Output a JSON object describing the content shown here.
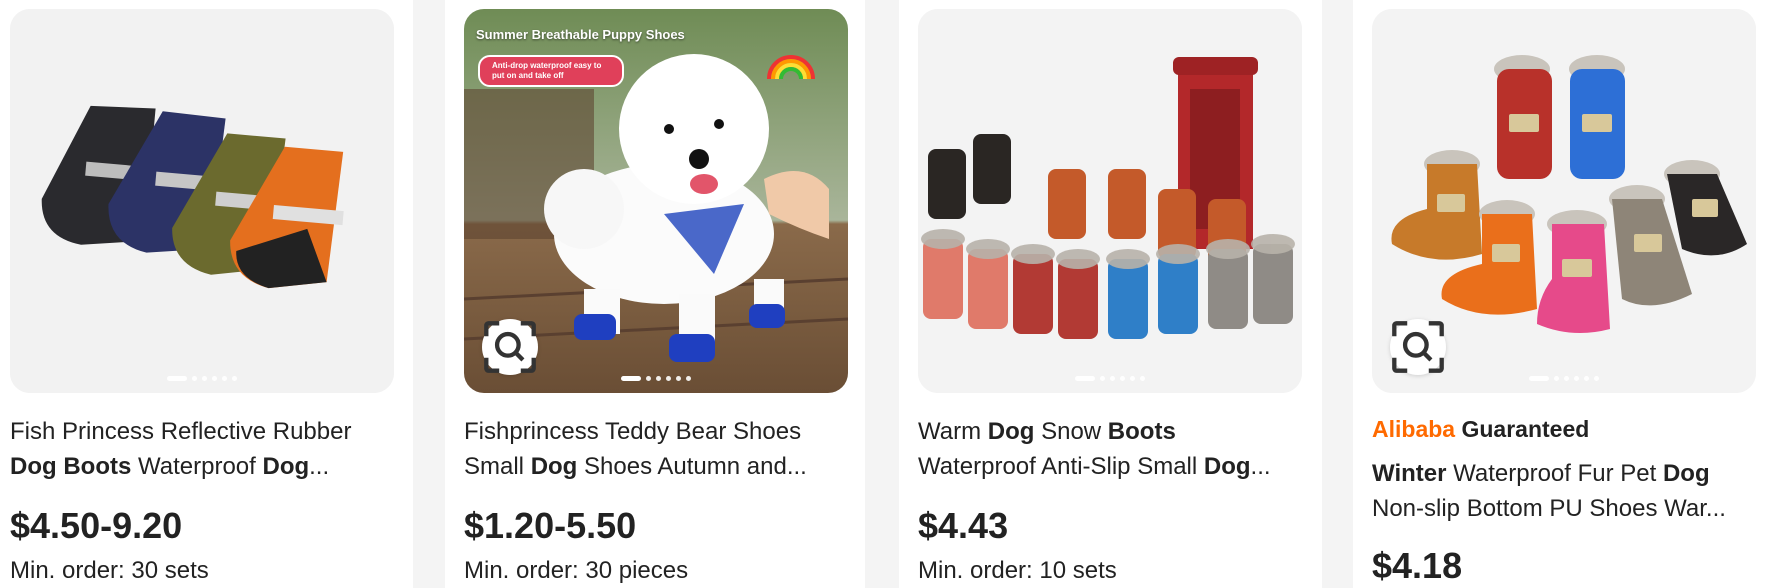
{
  "products": [
    {
      "title_line1": [
        {
          "t": "Fish Princess Reflective Rubber",
          "b": false
        }
      ],
      "title_line2": [
        {
          "t": "Dog",
          "b": true
        },
        {
          "t": " ",
          "b": false
        },
        {
          "t": "Boots",
          "b": true
        },
        {
          "t": " Waterproof ",
          "b": false
        },
        {
          "t": "Dog",
          "b": true
        },
        {
          "t": "...",
          "b": false
        }
      ],
      "price": "$4.50-9.20",
      "moq": "Min. order: 30 sets",
      "image_alt": "four-dog-boots-image",
      "has_lens": false
    },
    {
      "title_line1": [
        {
          "t": "Fishprincess Teddy Bear Shoes",
          "b": false
        }
      ],
      "title_line2": [
        {
          "t": "Small ",
          "b": false
        },
        {
          "t": "Dog",
          "b": true
        },
        {
          "t": " Shoes Autumn and...",
          "b": false
        }
      ],
      "price": "$1.20-5.50",
      "moq": "Min. order: 30 pieces",
      "image_alt": "white-poodle-wearing-shoes-image",
      "banner_title": "Summer Breathable Puppy Shoes",
      "banner_pill": "Anti-drop waterproof easy to put on and take off",
      "has_lens": true
    },
    {
      "title_line1": [
        {
          "t": "Warm ",
          "b": false
        },
        {
          "t": "Dog",
          "b": true
        },
        {
          "t": " Snow ",
          "b": false
        },
        {
          "t": "Boots",
          "b": true
        }
      ],
      "title_line2": [
        {
          "t": "Waterproof Anti-Slip Small ",
          "b": false
        },
        {
          "t": "Dog",
          "b": true
        },
        {
          "t": "...",
          "b": false
        }
      ],
      "price": "$4.43",
      "moq": "Min. order: 10 sets",
      "image_alt": "colorful-snow-boots-phone-booth-image",
      "has_lens": false
    },
    {
      "guarantee_brand": "Alibaba",
      "guarantee_label": "Guaranteed",
      "title_line1": [
        {
          "t": "Winter",
          "b": true
        },
        {
          "t": " Waterproof Fur Pet ",
          "b": false
        },
        {
          "t": "Dog",
          "b": true
        }
      ],
      "title_line2": [
        {
          "t": "Non-slip Bottom PU Shoes War...",
          "b": false
        }
      ],
      "price": "$4.18",
      "image_alt": "fur-lined-pet-shoes-image",
      "has_lens": true
    }
  ],
  "colors": {
    "alibaba_orange": "#ff6a00",
    "text": "#222222",
    "banner_pill": "#e0405a"
  },
  "carousel": {
    "total_slides": 6,
    "active_slide": 1
  }
}
